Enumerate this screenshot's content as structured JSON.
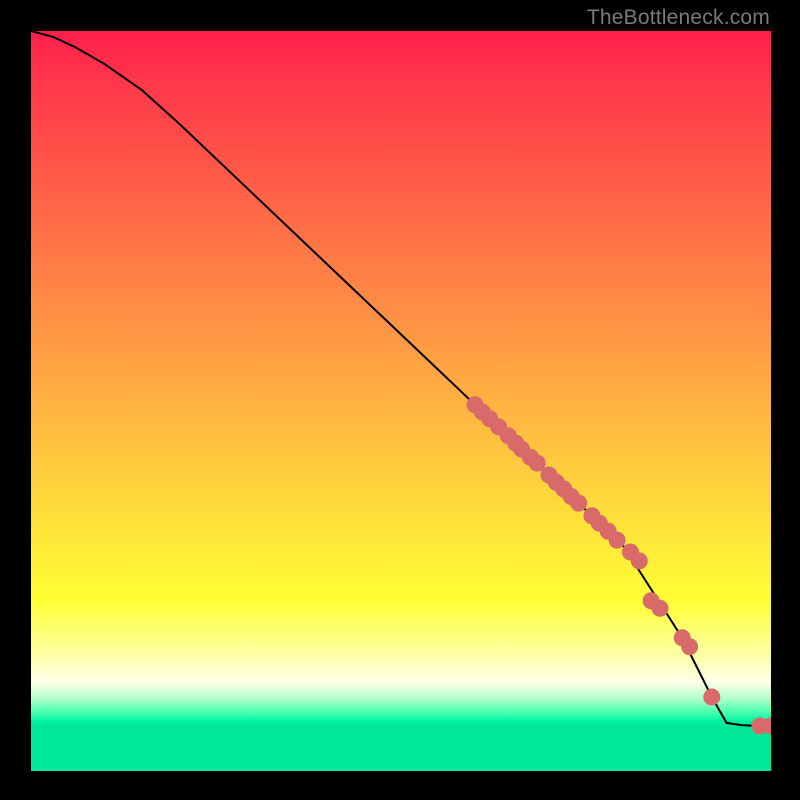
{
  "watermark": "TheBottleneck.com",
  "colors": {
    "curve_stroke": "#000000",
    "point_fill": "#d86a6a",
    "point_stroke": "#d86a6a",
    "gradient_top": "#ff1f4b",
    "gradient_bottom": "#00e79a",
    "background": "#000000"
  },
  "chart_data": {
    "type": "line",
    "title": "",
    "xlabel": "",
    "ylabel": "",
    "xlim": [
      0,
      100
    ],
    "ylim": [
      0,
      100
    ],
    "grid": false,
    "curve": {
      "x": [
        0,
        3,
        6,
        10,
        15,
        20,
        30,
        40,
        50,
        60,
        70,
        80,
        88,
        92,
        94,
        96,
        98,
        100
      ],
      "y": [
        100,
        99.2,
        97.8,
        95.5,
        92.0,
        87.5,
        78.0,
        68.5,
        59.0,
        49.5,
        40.0,
        30.5,
        18.0,
        10.0,
        6.5,
        6.2,
        6.1,
        6.1
      ]
    },
    "points": {
      "x": [
        60.0,
        61.0,
        62.0,
        63.2,
        64.5,
        65.5,
        66.3,
        67.5,
        68.4,
        70.0,
        71.0,
        72.0,
        73.0,
        74.0,
        75.8,
        76.8,
        78.0,
        79.2,
        81.0,
        82.2,
        83.8,
        85.0,
        88.0,
        89.0,
        92.0,
        98.5,
        100.0
      ],
      "y": [
        49.5,
        48.5,
        47.6,
        46.5,
        45.3,
        44.3,
        43.5,
        42.4,
        41.6,
        40.0,
        39.0,
        38.1,
        37.1,
        36.2,
        34.5,
        33.5,
        32.4,
        31.2,
        29.6,
        28.4,
        23.0,
        22.0,
        18.0,
        16.8,
        10.0,
        6.1,
        6.1
      ]
    }
  }
}
